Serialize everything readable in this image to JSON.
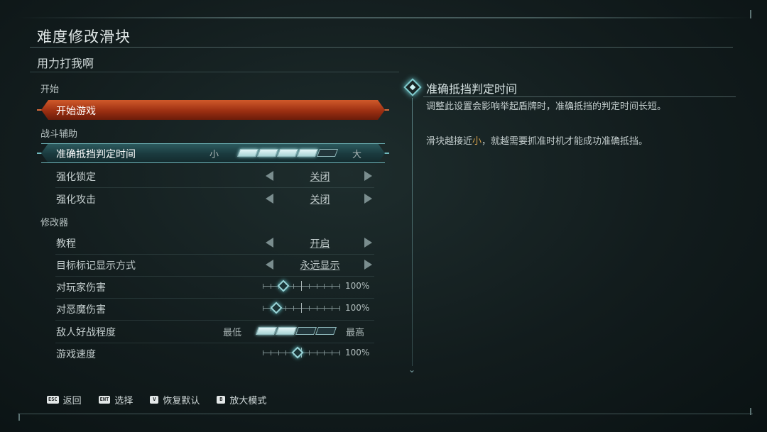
{
  "header": {
    "title": "难度修改滑块",
    "subtitle": "用力打我啊"
  },
  "sections": {
    "start": "开始",
    "combat": "战斗辅助",
    "modifiers": "修改器"
  },
  "start_row": {
    "label": "开始游戏"
  },
  "parry_row": {
    "label": "准确抵挡判定时间",
    "min": "小",
    "max": "大",
    "level": 4,
    "of": 5
  },
  "lock_row": {
    "label": "强化锁定",
    "value": "关闭"
  },
  "attack_row": {
    "label": "强化攻击",
    "value": "关闭"
  },
  "tutorial_row": {
    "label": "教程",
    "value": "开启"
  },
  "marker_row": {
    "label": "目标标记显示方式",
    "value": "永远显示"
  },
  "player_damage_row": {
    "label": "对玩家伤害",
    "value": "100%",
    "position": 0.27
  },
  "demon_damage_row": {
    "label": "对恶魔伤害",
    "value": "100%",
    "position": 0.18
  },
  "aggression_row": {
    "label": "敌人好战程度",
    "min": "最低",
    "max": "最高",
    "level": 2,
    "of": 4
  },
  "speed_row": {
    "label": "游戏速度",
    "value": "100%",
    "position": 0.45
  },
  "detail": {
    "title": "准确抵挡判定时间",
    "para1": "调整此设置会影响举起盾牌时，准确抵挡的判定时间长短。",
    "para2_a": "滑块越接近",
    "para2_hl": "小",
    "para2_b": "，就越需要抓准时机才能成功准确抵挡。"
  },
  "footer": {
    "back": {
      "key": "ESC",
      "label": "返回"
    },
    "select": {
      "key": "ENT",
      "label": "选择"
    },
    "reset": {
      "key": "V",
      "label": "恢复默认"
    },
    "zoom": {
      "key": "B",
      "label": "放大模式"
    }
  },
  "colors": {
    "accent_orange": "#c9491d",
    "accent_teal": "#6fb9bd",
    "highlight": "#d8a14a"
  }
}
